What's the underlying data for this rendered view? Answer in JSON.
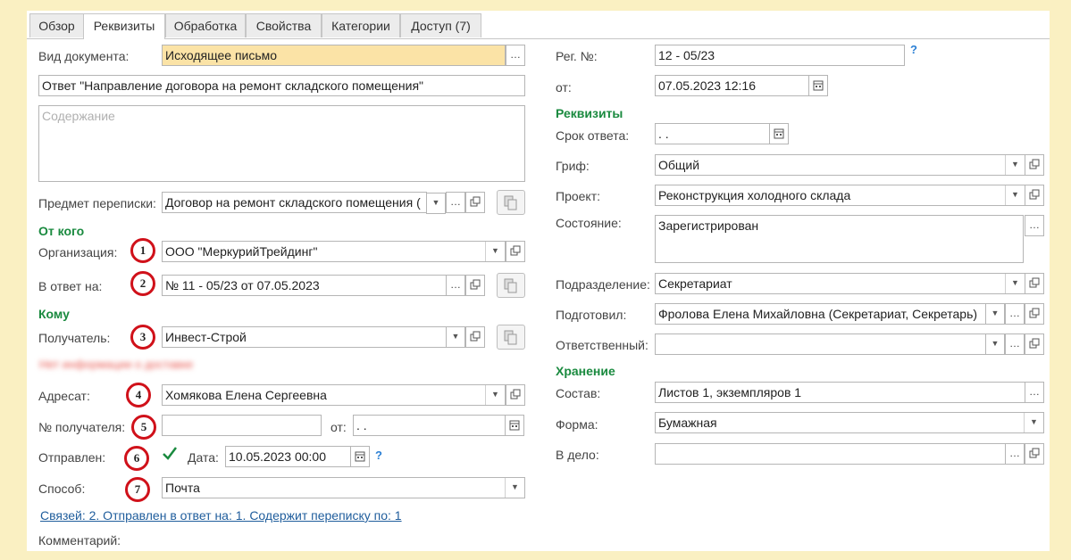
{
  "tabs": [
    "Обзор",
    "Реквизиты",
    "Обработка",
    "Свойства",
    "Категории",
    "Доступ (7)"
  ],
  "active_tab": "Реквизиты",
  "left": {
    "doc_type_label": "Вид документа:",
    "doc_type_value": "Исходящее письмо",
    "title_value": "Ответ \"Направление договора на ремонт складского помещения\"",
    "content_placeholder": "Содержание",
    "subject_label": "Предмет переписки:",
    "subject_value": "Договор на ремонт складского помещения (",
    "from_section": "От кого",
    "org_label": "Организация:",
    "org_value": "ООО \"МеркурийТрейдинг\"",
    "reply_label": "В ответ на:",
    "reply_value": "№ 11 - 05/23 от 07.05.2023",
    "to_section": "Кому",
    "recipient_label": "Получатель:",
    "recipient_value": "Инвест-Строй",
    "blurred_text": "Нет информации о доставке",
    "addressee_label": "Адресат:",
    "addressee_value": "Хомякова Елена Сергеевна",
    "recipient_no_label": "№ получателя:",
    "recipient_no_value": "",
    "from_date_label": "от:",
    "from_date_value": ".  .",
    "sent_label": "Отправлен:",
    "sent_checked": true,
    "date_label": "Дата:",
    "date_value": "10.05.2023 00:00",
    "method_label": "Способ:",
    "method_value": "Почта",
    "links_text": "Связей: 2. Отправлен в ответ на: 1. Содержит переписку по: 1",
    "comment_label": "Комментарий:",
    "help_mark": "?"
  },
  "markers": [
    "1",
    "2",
    "3",
    "4",
    "5",
    "6",
    "7"
  ],
  "right": {
    "reg_no_label": "Рег. №:",
    "reg_no_value": "12 - 05/23",
    "help_mark": "?",
    "reg_date_label": "от:",
    "reg_date_value": "07.05.2023 12:16",
    "req_section": "Реквизиты",
    "deadline_label": "Срок ответа:",
    "deadline_value": ".  .",
    "grif_label": "Гриф:",
    "grif_value": "Общий",
    "project_label": "Проект:",
    "project_value": "Реконструкция холодного склада",
    "state_label": "Состояние:",
    "state_value": "Зарегистрирован",
    "dept_label": "Подразделение:",
    "dept_value": "Секретариат",
    "prepared_label": "Подготовил:",
    "prepared_value": "Фролова Елена Михайловна (Секретариат, Секретарь)",
    "responsible_label": "Ответственный:",
    "responsible_value": "",
    "storage_section": "Хранение",
    "composition_label": "Состав:",
    "composition_value": "Листов 1, экземпляров 1",
    "form_label": "Форма:",
    "form_value": "Бумажная",
    "case_label": "В дело:",
    "case_value": ""
  },
  "colors": {
    "background": "#faf0c2",
    "section": "#1a8a3f",
    "marker": "#d0111a",
    "highlight": "#fbe3a6",
    "link": "#1f5d9c"
  },
  "icons": {
    "select_button": "ellipsis",
    "open_button": "open-window-icon",
    "dropdown": "triangle-down",
    "calendar": "calendar-icon",
    "copy": "copy-icon",
    "checkbox": "checkmark"
  }
}
